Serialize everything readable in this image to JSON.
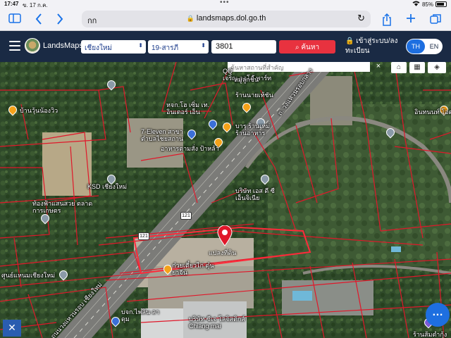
{
  "status_bar": {
    "time": "17:47",
    "date": "ข. 17 ก.ค.",
    "battery_pct": "85%",
    "battery_level": 0.85
  },
  "browser": {
    "tab_text": "กก",
    "domain": "landsmaps.dol.go.th"
  },
  "header": {
    "brand": "LandsMaps",
    "province": "เชียงใหม่",
    "district": "19-สารภี",
    "parcel_no": "3801",
    "search_label": "ค้นหา",
    "login_label": "เข้าสู่ระบบ/ลงทะเบียน",
    "lang_th": "TH",
    "lang_en": "EN"
  },
  "map": {
    "search_placeholder": "ค้นหาสถานที่สำคัญ",
    "close_symbol": "×",
    "route_number": "121",
    "labels": {
      "lbl1": "บ้านวุ้นน้องวิว",
      "lbl2": "7-Eleven สาขา ตำบลไชยสถาน",
      "lbl3": "หจก.โฮ เซิ่ม เท. อินเตอร์ เอ็น",
      "lbl4": "อาหารตามสั่ง ป้าหล้า",
      "lbl5": "ร้านนายเท้ชัน",
      "lbl6": "บารุ ร้านเหม่",
      "lbl7": "ร้านอาหาร",
      "lbl8": "เจริญ ออโต้ พาร์ท",
      "lbl9": "KSD เชียงใหม่",
      "lbl10": "ท้องฟ้าแสนสวย ตลาดการเกษตร",
      "lbl11": "ศูนย์แหนมเชียงใหม่",
      "lbl12": "บริษัท เอส ดี ซี เอ็นจิเนีย",
      "lbl13": "ก๋วยเตี๋ยวไก่ ตุ๋นยาจีน",
      "lbl14": "ถ. วงแหวนรอบกลาง",
      "lbl15": "ถนนวงแหวนรอบ เชียงใหม่",
      "lbl16": "บริษัท ซีเจ โลจิสติกส์ Chiang mai",
      "lbl17": "บจก.ไพลิน ลาดุม",
      "lbl18": "อินทนนท์ โอต",
      "lbl19": "ร้านส้มตำกุ้ง",
      "lbl20": "QQ",
      "lbl21": "หมู่ลูกชิ้น",
      "lbl22": "แปลงที่ดิน"
    },
    "icons": {
      "search": "search-icon",
      "home": "home-icon",
      "grid": "grid-icon",
      "layers": "layers-icon",
      "fab": "more-icon",
      "tool": "ruler-icon"
    },
    "colors": {
      "parcel_lines": "#e0182a",
      "marker": "#e0182a",
      "header_bg": "#1a2a44",
      "accent": "#1e6fe0"
    }
  }
}
